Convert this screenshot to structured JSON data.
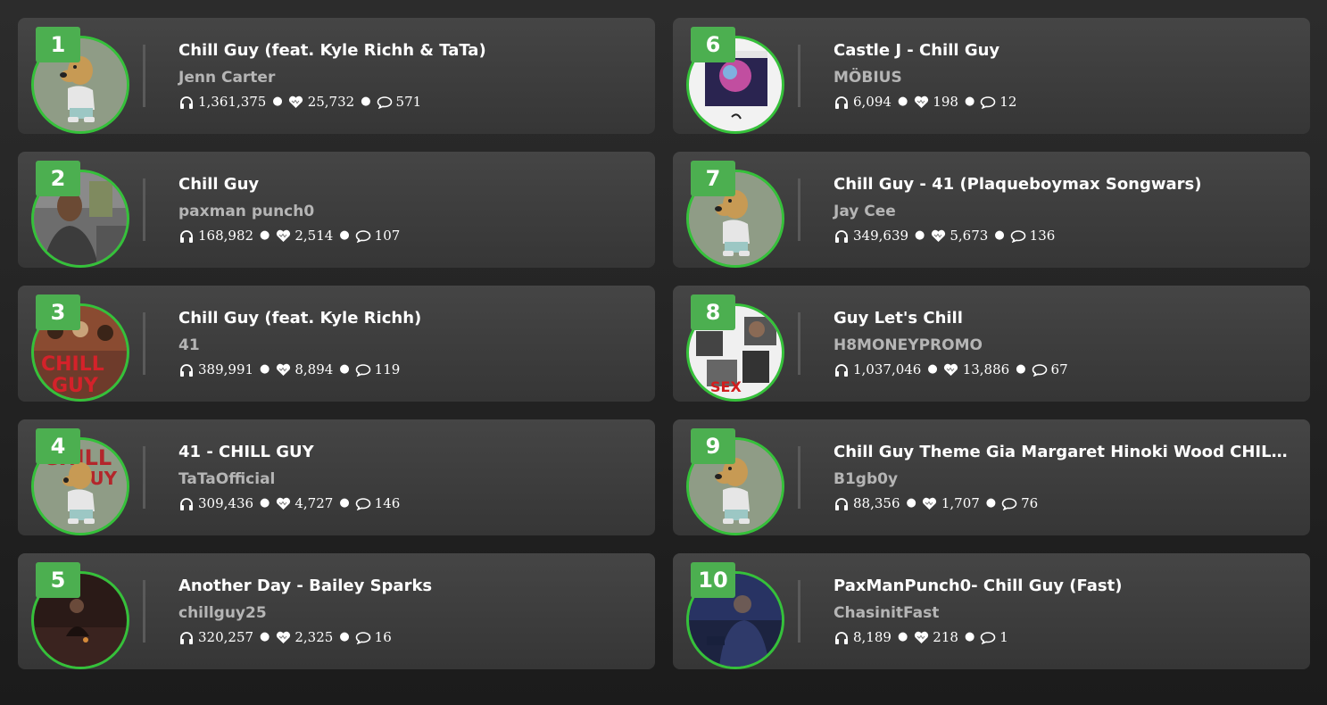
{
  "colors": {
    "accent_green": "#4caf50",
    "ring_green": "#35c13a",
    "card_bg": "#3e3e3e",
    "artist_gray": "#b5b5b5"
  },
  "icons": {
    "listens": "headphones-icon",
    "likes": "heart-icon",
    "comments": "comment-icon"
  },
  "tracks": [
    {
      "rank": "1",
      "title": "Chill Guy (feat. Kyle Richh & TaTa)",
      "artist": "Jenn Carter",
      "plays": "1,361,375",
      "likes": "25,732",
      "comments": "571",
      "art": "dog"
    },
    {
      "rank": "2",
      "title": "Chill Guy",
      "artist": "paxman punch0",
      "plays": "168,982",
      "likes": "2,514",
      "comments": "107",
      "art": "photo-person"
    },
    {
      "rank": "3",
      "title": "Chill Guy (feat. Kyle Richh)",
      "artist": "41",
      "plays": "389,991",
      "likes": "8,894",
      "comments": "119",
      "art": "red-text"
    },
    {
      "rank": "4",
      "title": "41 - CHILL GUY",
      "artist": "TaTaOfficial",
      "plays": "309,436",
      "likes": "4,727",
      "comments": "146",
      "art": "dog-red"
    },
    {
      "rank": "5",
      "title": "Another Day - Bailey Sparks",
      "artist": "chillguy25",
      "plays": "320,257",
      "likes": "2,325",
      "comments": "16",
      "art": "dark-photo"
    },
    {
      "rank": "6",
      "title": "Castle J - Chill Guy",
      "artist": "MÖBIUS",
      "plays": "6,094",
      "likes": "198",
      "comments": "12",
      "art": "album-purple"
    },
    {
      "rank": "7",
      "title": "Chill Guy - 41 (Plaqueboymax Songwars)",
      "artist": "Jay Cee",
      "plays": "349,639",
      "likes": "5,673",
      "comments": "136",
      "art": "dog"
    },
    {
      "rank": "8",
      "title": "Guy Let's Chill",
      "artist": "H8MONEYPROMO",
      "plays": "1,037,046",
      "likes": "13,886",
      "comments": "67",
      "art": "collage"
    },
    {
      "rank": "9",
      "title": "Chill Guy Theme Gia Margaret Hinoki Wood CHILL PIA...",
      "artist": "B1gb0y",
      "plays": "88,356",
      "likes": "1,707",
      "comments": "76",
      "art": "dog"
    },
    {
      "rank": "10",
      "title": "PaxManPunch0- Chill Guy (Fast)",
      "artist": "ChasinitFast",
      "plays": "8,189",
      "likes": "218",
      "comments": "1",
      "art": "blue-night"
    }
  ]
}
